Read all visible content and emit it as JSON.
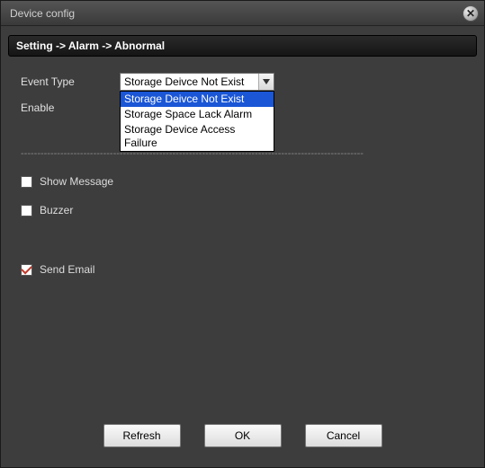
{
  "window": {
    "title": "Device config"
  },
  "breadcrumb": "Setting -> Alarm -> Abnormal",
  "labels": {
    "event_type": "Event Type",
    "enable": "Enable",
    "show_message": "Show Message",
    "buzzer": "Buzzer",
    "send_email": "Send Email"
  },
  "event_type": {
    "selected": "Storage Deivce Not Exist",
    "options": [
      "Storage Deivce Not Exist",
      "Storage Space Lack Alarm",
      "Storage Device Access Failure"
    ]
  },
  "checkboxes": {
    "show_message": false,
    "buzzer": false,
    "send_email": true
  },
  "buttons": {
    "refresh": "Refresh",
    "ok": "OK",
    "cancel": "Cancel"
  },
  "divider": "--------------------------------------------------------------------------------------------------------"
}
